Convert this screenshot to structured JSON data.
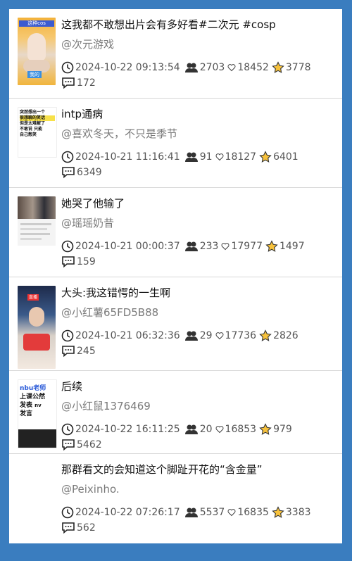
{
  "items": [
    {
      "title": "这我都不敢想出片会有多好看#二次元 #cosp",
      "author": "@次元游戏",
      "datetime": "2024-10-22 09:13:54",
      "followers": "2703",
      "likes": "18452",
      "stars": "3778",
      "comments": "172",
      "thumb_text": [
        "这种cos",
        "我的"
      ]
    },
    {
      "title": "intp通病",
      "author": "@喜欢冬天，不只是季节",
      "datetime": "2024-10-21 11:16:41",
      "followers": "91",
      "likes": "18127",
      "stars": "6401",
      "comments": "6349",
      "thumb_text": [
        "突然想出一个",
        "很想聊的笑话",
        "但是太难解了",
        "不敢说 只能",
        "自己憋笑"
      ]
    },
    {
      "title": "她哭了他输了",
      "author": "@瑶瑶奶昔",
      "datetime": "2024-10-21 00:00:37",
      "followers": "233",
      "likes": "17977",
      "stars": "1497",
      "comments": "159",
      "thumb_text": []
    },
    {
      "title": "大头:我这错愕的一生啊",
      "author": "@小红薯65FD5B88",
      "datetime": "2024-10-21 06:32:36",
      "followers": "29",
      "likes": "17736",
      "stars": "2826",
      "comments": "245",
      "thumb_text": [
        "直播"
      ]
    },
    {
      "title": "后续",
      "author": "@小红鼠1376469",
      "datetime": "2024-10-22 16:11:25",
      "followers": "20",
      "likes": "16853",
      "stars": "979",
      "comments": "5462",
      "thumb_text": [
        "nbu老师",
        "上课公然",
        "发表",
        "nv",
        "发言"
      ]
    },
    {
      "title": "那群看文的会知道这个脚趾开花的“含金量”",
      "author": "@Peixinho.",
      "datetime": "2024-10-22 07:26:17",
      "followers": "5537",
      "likes": "16835",
      "stars": "3383",
      "comments": "562",
      "thumb_text": []
    }
  ]
}
